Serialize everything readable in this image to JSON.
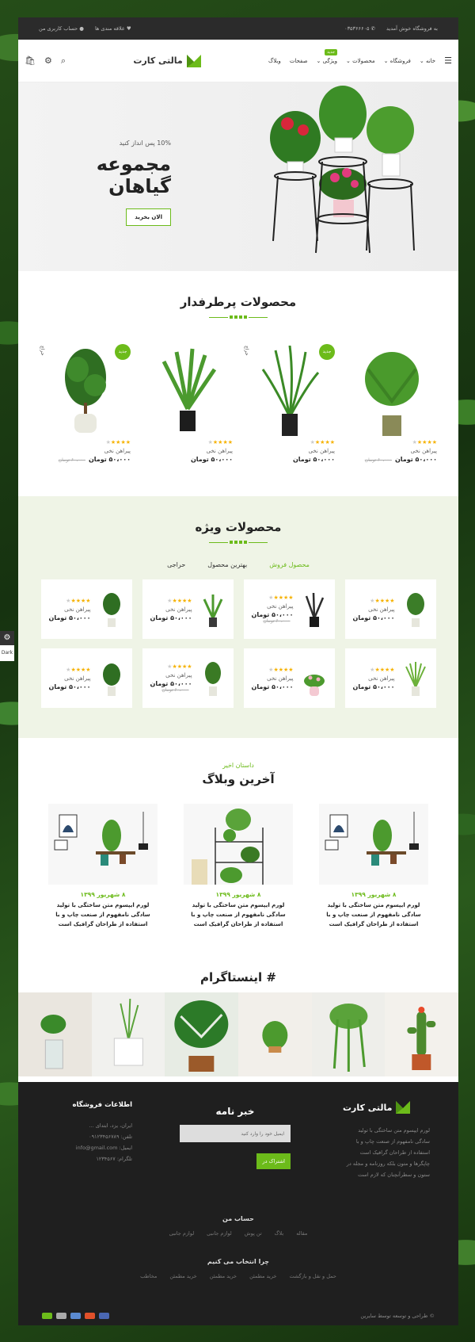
{
  "topbar": {
    "welcome": "به فروشگاه خوش آمدید",
    "phone": "۰۳۵۳۶۶۶۰۵",
    "wishlist": "علاقه مندی ها",
    "account": "حساب کاربری من"
  },
  "nav": {
    "home": "خانه",
    "shop": "فروشگاه",
    "products": "محصولات",
    "features": "ویژگی",
    "features_badge": "جدید",
    "pages": "صفحات",
    "blog": "وبلاگ"
  },
  "logo": {
    "text": "مالتی کارت"
  },
  "hero": {
    "subtitle": "10% پس انداز کنید",
    "title": "مجموعه گیاهان",
    "button": "الان بخرید"
  },
  "popular": {
    "title": "محصولات پرطرفدار",
    "items": [
      {
        "name": "پیراهن نخی",
        "price": "۵۰،۰۰۰ تومان",
        "old": "۶۰،۰۰۰ تومان",
        "badge": "",
        "sale": ""
      },
      {
        "name": "پیراهن نخی",
        "price": "۵۰،۰۰۰ تومان",
        "old": "",
        "badge": "جدید",
        "sale": "حراج"
      },
      {
        "name": "پیراهن نخی",
        "price": "۵۰،۰۰۰ تومان",
        "old": "",
        "badge": "",
        "sale": ""
      },
      {
        "name": "پیراهن نخی",
        "price": "۵۰،۰۰۰ تومان",
        "old": "۶۰،۰۰۰ تومان",
        "badge": "جدید",
        "sale": "حراج"
      }
    ]
  },
  "special": {
    "title": "محصولات ویژه",
    "tabs": [
      "محصول فروش",
      "بهترین محصول",
      "حراجی"
    ],
    "item_name": "پیراهن نخی",
    "item_price": "۵۰،۰۰۰ تومان",
    "item_old": "۶۰،۰۰۰ تومان"
  },
  "blog": {
    "kicker": "داستان اخیر",
    "title": "آخرین وبلاگ",
    "date": "۸ شهریور ۱۳۹۹",
    "text": "لورم ایپسوم متن ساختگی با تولید سادگی نامفهوم از صنعت چاپ و با استفاده از طراحان گرافیک است"
  },
  "instagram": {
    "title": "# اینستاگرام"
  },
  "footer": {
    "logo": "مالتی کارت",
    "about": "لورم ایپسوم متن ساختگی با تولید سادگی نامفهوم از صنعت چاپ و با استفاده از طراحان گرافیک است چاپگرها و متون بلکه روزنامه و مجله در ستون و سطرآنچنان که لازم است",
    "newsletter_title": "خبر نامه",
    "newsletter_placeholder": "ایمیل خود را وارد کنید",
    "newsletter_button": "اشتراک در",
    "info_title": "اطلاعات فروشگاه",
    "info_lines": [
      "ایران، یزد، ابتدای ...",
      "تلفن: ۰۹۱۲۳۴۵۶۷۸۹",
      "ایمیل: info@gmail.com",
      "تلگرام: ۱۲۳۴۵۶۷"
    ],
    "account_title": "حساب من",
    "account_links": [
      "مقاله",
      "بلاگ",
      "تن پوش",
      "لوازم جانبی",
      "لوازم جانبی"
    ],
    "why_title": "چرا انتخاب می کنیم",
    "why_links": [
      "حمل و نقل و بازگشت",
      "خرید مطمئن",
      "خرید مطمئن",
      "خرید مطمئن",
      "مخاطب"
    ],
    "copyright": "© طراحی و توسعه توسط سایرین"
  },
  "side": {
    "dark": "Dark"
  },
  "colors": {
    "accent": "#6cbb1a",
    "footer": "#1f1f1f",
    "special_bg": "#eff4e6"
  }
}
